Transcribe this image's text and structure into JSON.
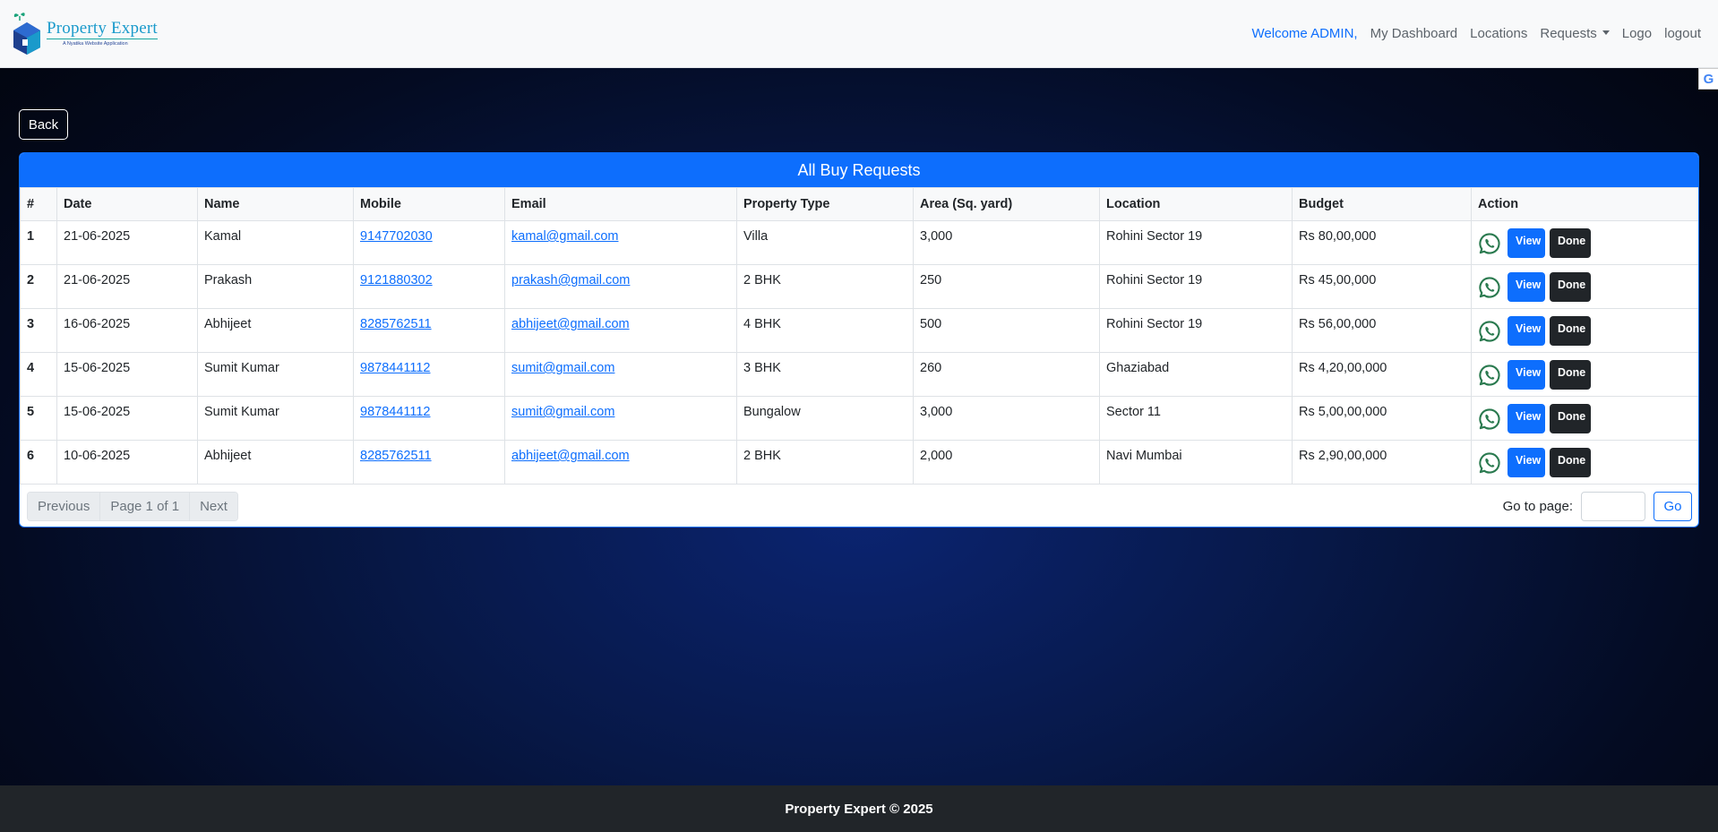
{
  "brand": {
    "name": "Property Expert",
    "tagline": "A Nyatika Website Application"
  },
  "nav": {
    "welcome": "Welcome ADMIN,",
    "dashboard": "My Dashboard",
    "locations": "Locations",
    "requests": "Requests",
    "logo": "Logo",
    "logout": "logout"
  },
  "google_badge": "G",
  "back_label": "Back",
  "card": {
    "title": "All Buy Requests",
    "columns": [
      "#",
      "Date",
      "Name",
      "Mobile",
      "Email",
      "Property Type",
      "Area (Sq. yard)",
      "Location",
      "Budget",
      "Action"
    ],
    "rows": [
      {
        "idx": "1",
        "date": "21-06-2025",
        "name": "Kamal",
        "mobile": "9147702030",
        "email": "kamal@gmail.com",
        "type": "Villa",
        "area": "3,000",
        "location": "Rohini Sector 19",
        "budget": "Rs 80,00,000"
      },
      {
        "idx": "2",
        "date": "21-06-2025",
        "name": "Prakash",
        "mobile": "9121880302",
        "email": "prakash@gmail.com",
        "type": "2 BHK",
        "area": "250",
        "location": "Rohini Sector 19",
        "budget": "Rs 45,00,000"
      },
      {
        "idx": "3",
        "date": "16-06-2025",
        "name": "Abhijeet",
        "mobile": "8285762511",
        "email": "abhijeet@gmail.com",
        "type": "4 BHK",
        "area": "500",
        "location": "Rohini Sector 19",
        "budget": "Rs 56,00,000"
      },
      {
        "idx": "4",
        "date": "15-06-2025",
        "name": "Sumit Kumar",
        "mobile": "9878441112",
        "email": "sumit@gmail.com",
        "type": "3 BHK",
        "area": "260",
        "location": "Ghaziabad",
        "budget": "Rs 4,20,00,000"
      },
      {
        "idx": "5",
        "date": "15-06-2025",
        "name": "Sumit Kumar",
        "mobile": "9878441112",
        "email": "sumit@gmail.com",
        "type": "Bungalow",
        "area": "3,000",
        "location": "Sector 11",
        "budget": "Rs 5,00,00,000"
      },
      {
        "idx": "6",
        "date": "10-06-2025",
        "name": "Abhijeet",
        "mobile": "8285762511",
        "email": "abhijeet@gmail.com",
        "type": "2 BHK",
        "area": "2,000",
        "location": "Navi Mumbai",
        "budget": "Rs 2,90,00,000"
      }
    ],
    "view_label": "View",
    "done_label": "Done"
  },
  "pagination": {
    "previous": "Previous",
    "page_info": "Page 1 of 1",
    "next": "Next",
    "goto_label": "Go to page:",
    "goto_value": "",
    "go_label": "Go"
  },
  "footer": "Property Expert © 2025",
  "colors": {
    "primary": "#0d6efd",
    "dark": "#212529",
    "whatsapp": "#2a7a4f"
  }
}
